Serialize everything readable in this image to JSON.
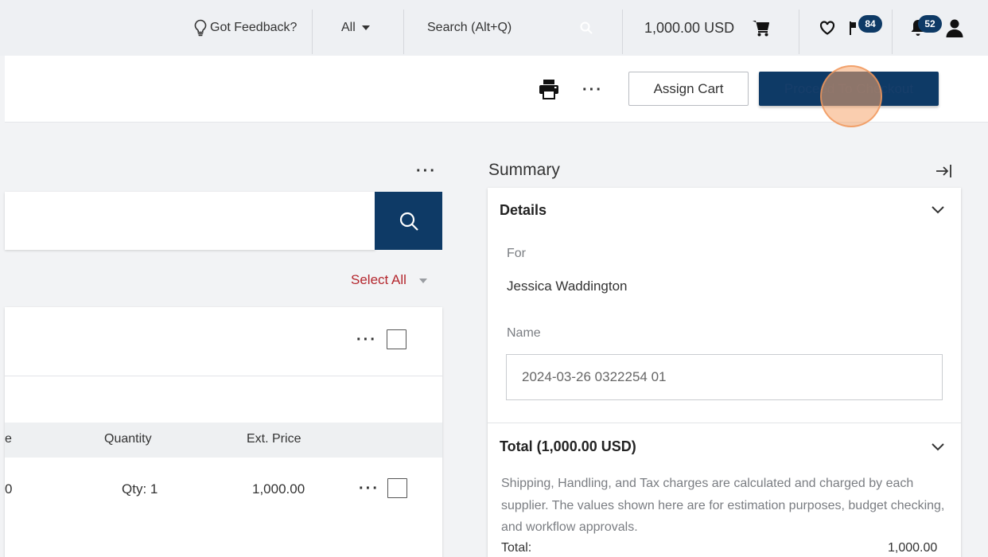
{
  "topbar": {
    "feedback_label": "Got Feedback?",
    "scope_label": "All",
    "search_placeholder": "Search (Alt+Q)",
    "cart_total": "1,000.00 USD",
    "flag_badge": "84",
    "notif_badge": "52"
  },
  "actions": {
    "assign_cart": "Assign Cart",
    "proceed_checkout": "Proceed To Checkout"
  },
  "cart": {
    "select_all": "Select All",
    "columns": {
      "price_fragment": "e",
      "quantity": "Quantity",
      "ext_price": "Ext. Price"
    },
    "row": {
      "price_fragment": "0",
      "quantity": "Qty: 1",
      "ext_price": "1,000.00"
    }
  },
  "summary": {
    "title": "Summary",
    "details_label": "Details",
    "for_label": "For",
    "for_value": "Jessica Waddington",
    "name_label": "Name",
    "name_value": "2024-03-26 0322254 01",
    "total_label": "Total (1,000.00 USD)",
    "note": "Shipping, Handling, and Tax charges are calculated and charged by each supplier. The values shown here are for estimation purposes, budget checking, and workflow approvals.",
    "total_row_label": "Total:",
    "total_row_value": "1,000.00"
  },
  "colors": {
    "primary": "#0e3a66",
    "accent_red": "#b4262d",
    "background": "#f2f3f5"
  }
}
